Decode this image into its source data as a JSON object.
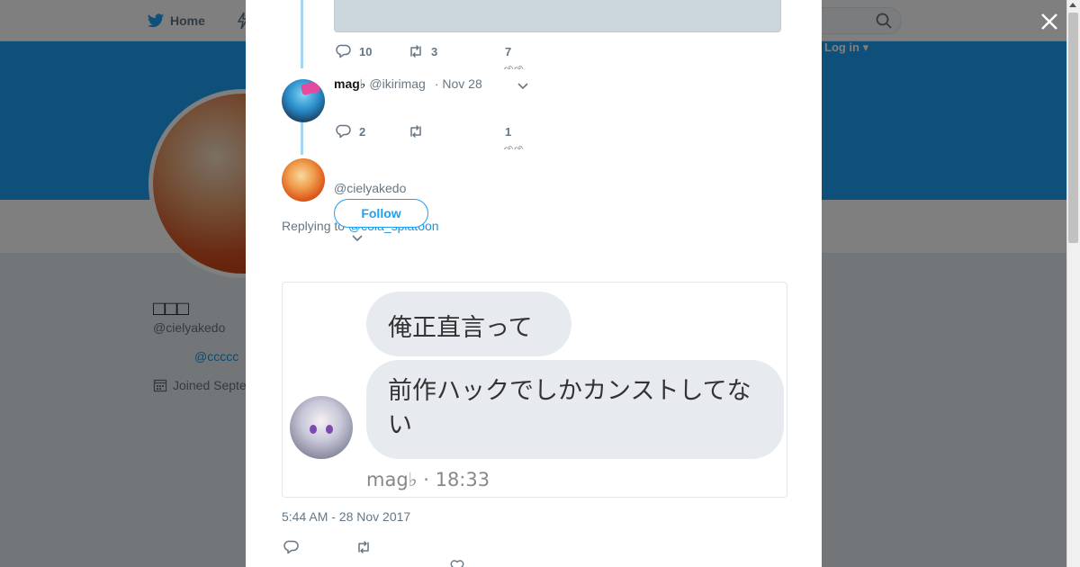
{
  "nav": {
    "home_label": "Home",
    "login_label": "Log in ▾"
  },
  "profile": {
    "display_name": "□□□",
    "handle": "@cielyakedo",
    "link": "@ccccc",
    "joined": "Joined Septe"
  },
  "modal": {
    "parent_tweet": {
      "reply_count": "10",
      "retweet_count": "3",
      "like_count": "7"
    },
    "reply_tweet": {
      "name": "mag♭",
      "handle": "@ikirimag",
      "date": "· Nov 28",
      "reply_count": "2",
      "retweet_count": "",
      "like_count": "1"
    },
    "main_tweet": {
      "handle": "@cielyakedo",
      "follow_label": "Follow",
      "replying_prefix": "Replying to",
      "replying_to": "@cola_splatoon",
      "image": {
        "bubble_1": "俺正直言って",
        "bubble_2": "前作ハックでしかカンストしてない",
        "meta": "mag♭ · 18:33"
      },
      "timestamp": "5:44 AM - 28 Nov 2017"
    }
  },
  "colors": {
    "accent": "#1da1f2",
    "banner": "#1da1f2",
    "thread_line": "#a5d7f5"
  }
}
